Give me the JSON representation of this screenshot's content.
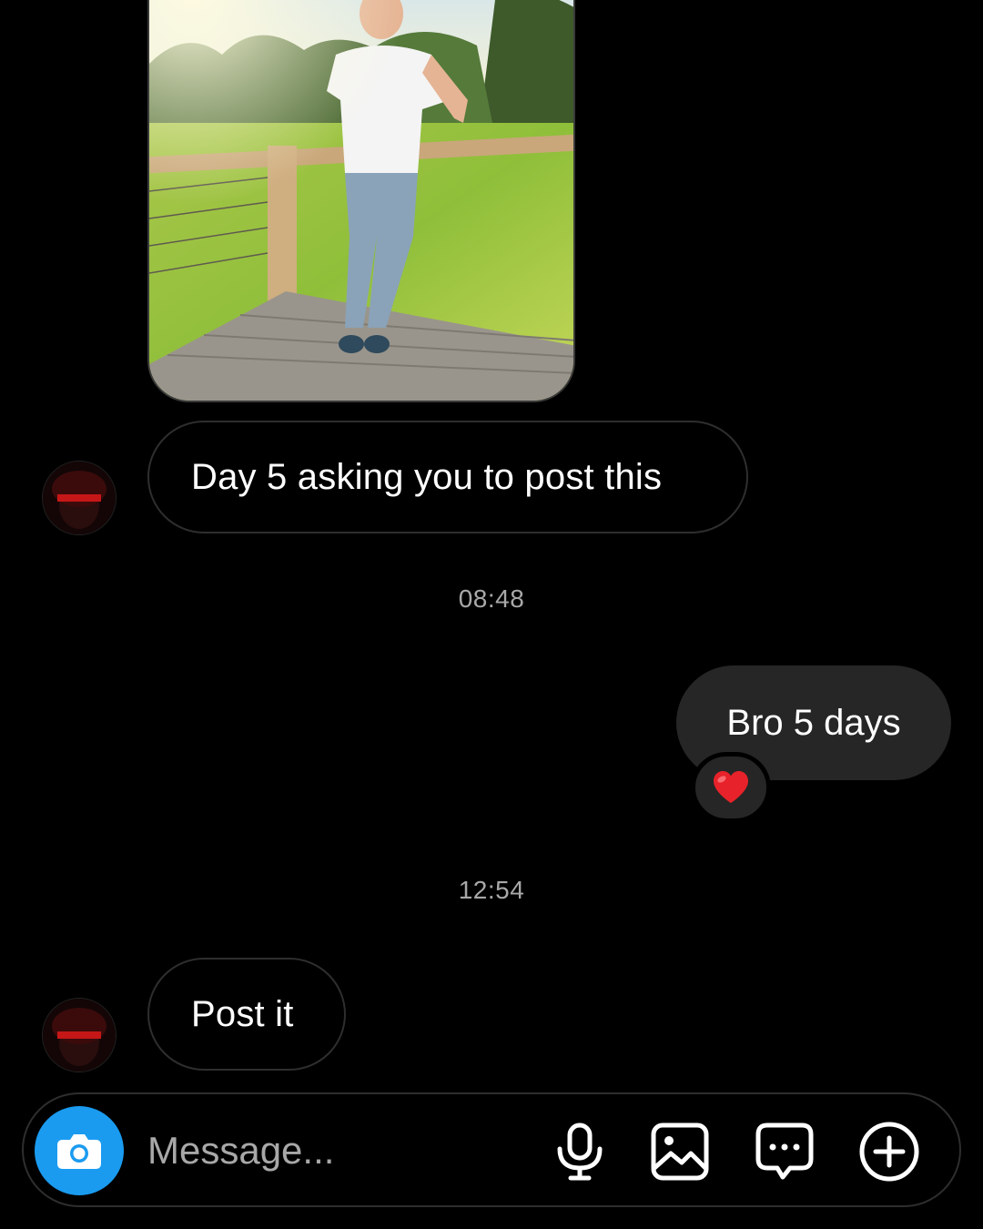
{
  "thread": {
    "messages": [
      {
        "type": "text",
        "direction": "received",
        "text": "Day 5 asking you to post this"
      },
      {
        "type": "text",
        "direction": "sent",
        "text": "Bro 5 days",
        "reaction": "❤️"
      },
      {
        "type": "text",
        "direction": "received",
        "text": "Post it"
      }
    ],
    "timestamps": [
      "08:48",
      "12:54"
    ]
  },
  "composer": {
    "placeholder": "Message...",
    "icons": [
      "camera-icon",
      "microphone-icon",
      "gallery-icon",
      "sticker-icon",
      "plus-icon"
    ]
  },
  "colors": {
    "background": "#000000",
    "sent_bubble": "#262626",
    "received_border": "#2e2e2e",
    "timestamp": "#a8a8a8",
    "accent": "#1a9bf0"
  }
}
